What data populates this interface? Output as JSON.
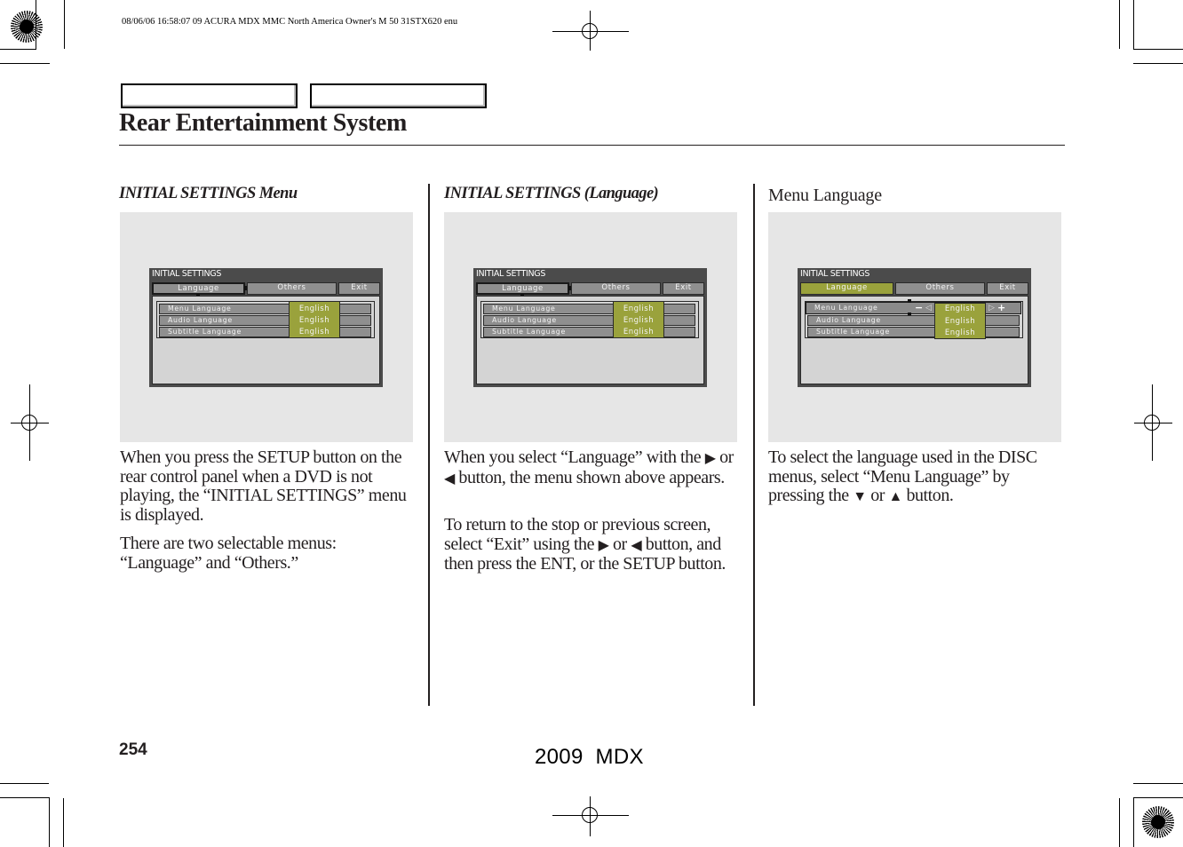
{
  "print_info": "08/06/06 16:58:07    09 ACURA MDX MMC North America Owner's M 50 31STX620 enu",
  "header": {
    "tabs": [
      "",
      ""
    ],
    "title": "Rear Entertainment System"
  },
  "columns": [
    {
      "heading": "INITIAL SETTINGS Menu",
      "heading_style": "bold-italic",
      "screen": {
        "title": "INITIAL  SETTINGS",
        "tabs": [
          {
            "label": "Language",
            "state": "focused"
          },
          {
            "label": "Others",
            "state": "normal"
          },
          {
            "label": "Exit",
            "state": "normal"
          }
        ],
        "rows": [
          {
            "label": "Menu  Language",
            "value": "English"
          },
          {
            "label": "Audio  Language",
            "value": "English"
          },
          {
            "label": "Subtitle  Language",
            "value": "English"
          }
        ]
      },
      "paragraphs": [
        "When you press the SETUP button on the rear control panel when a DVD is not playing, the “INITIAL SETTINGS” menu is displayed.",
        "There are two selectable menus: “Language” and “Others.”"
      ]
    },
    {
      "heading": "INITIAL SETTINGS (Language)",
      "heading_style": "bold-italic",
      "screen": {
        "title": "INITIAL  SETTINGS",
        "tabs": [
          {
            "label": "Language",
            "state": "focused"
          },
          {
            "label": "Others",
            "state": "normal"
          },
          {
            "label": "Exit",
            "state": "normal"
          }
        ],
        "rows": [
          {
            "label": "Menu  Language",
            "value": "English"
          },
          {
            "label": "Audio  Language",
            "value": "English"
          },
          {
            "label": "Subtitle  Language",
            "value": "English"
          }
        ]
      },
      "paragraphs": [
        {
          "before": "When you select “Language” with the ",
          "icon1": "▶",
          "mid": " or ",
          "icon2": "◀",
          "after": " button, the menu shown above appears."
        },
        {
          "before": "To return to the stop or previous screen, select “Exit” using the ",
          "icon1": "▶",
          "mid": " or ",
          "icon2": "◀",
          "after": " button, and then press the ENT, or the SETUP button."
        }
      ]
    },
    {
      "heading": "Menu Language",
      "heading_style": "plain",
      "screen": {
        "title": "INITIAL  SETTINGS",
        "tabs": [
          {
            "label": "Language",
            "state": "selected"
          },
          {
            "label": "Others",
            "state": "normal"
          },
          {
            "label": "Exit",
            "state": "normal"
          }
        ],
        "rows": [
          {
            "label": "Menu  Language",
            "value": "English",
            "adjust_minus": "−",
            "adjust_plus": "+"
          },
          {
            "label": "Audio  Language",
            "value": "English"
          },
          {
            "label": "Subtitle  Language",
            "value": "English"
          }
        ]
      },
      "paragraphs": [
        {
          "before": "To select the language used in the DISC menus, select “Menu Language” by pressing the ",
          "icon1": "▼",
          "mid": " or ",
          "icon2": "▲",
          "after": " button."
        }
      ]
    }
  ],
  "colors": {
    "highlight_green": "#9aa23c",
    "osd_gray": "#8f8f8f",
    "osd_frame": "#4b4b4b",
    "figure_bg": "#e6e6e6"
  },
  "footer": {
    "page_number": "254",
    "model": "2009  MDX"
  }
}
